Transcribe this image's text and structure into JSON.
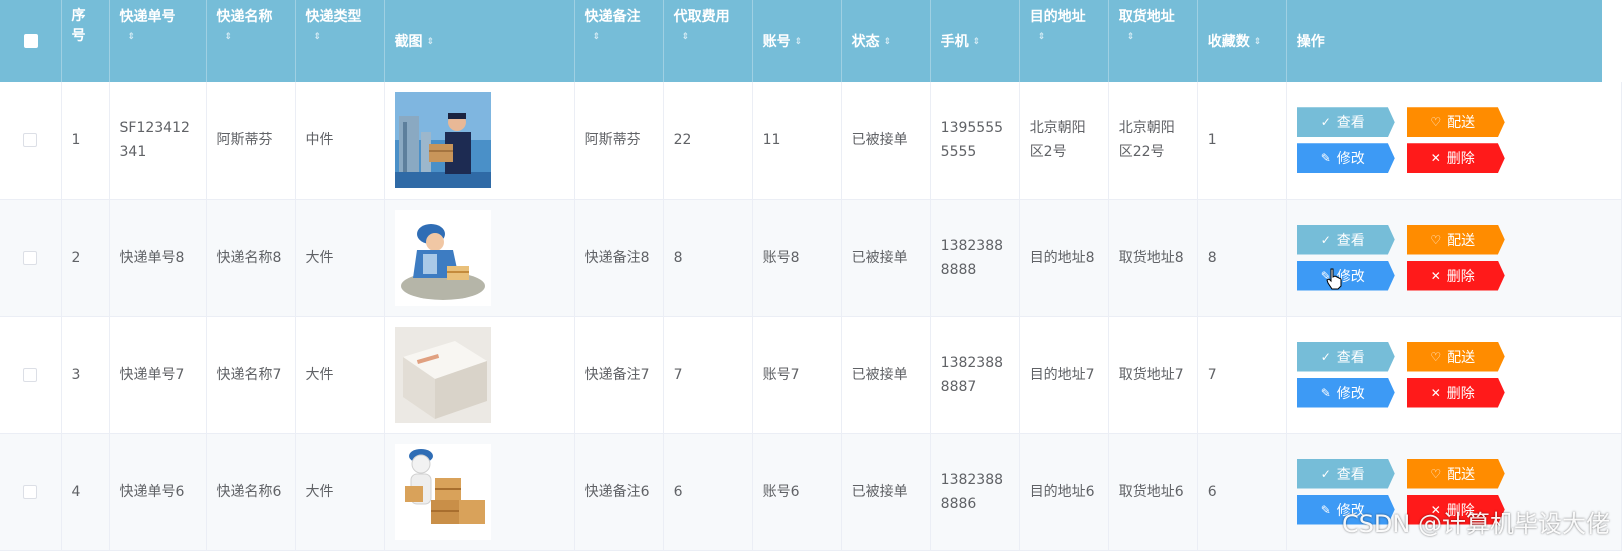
{
  "table": {
    "columns": {
      "index": "序号",
      "tracking_no": "快递单号",
      "name": "快递名称",
      "type": "快递类型",
      "screenshot": "截图",
      "remark": "快递备注",
      "fee": "代取费用",
      "account": "账号",
      "status": "状态",
      "phone": "手机",
      "destination": "目的地址",
      "pickup": "取货地址",
      "favorites": "收藏数",
      "actions": "操作"
    },
    "sort_icon": "⇕",
    "rows": [
      {
        "index": "1",
        "tracking_no": "SF123412341",
        "name": "阿斯蒂芬",
        "type": "中件",
        "remark": "阿斯蒂芬",
        "fee": "22",
        "account": "11",
        "status": "已被接单",
        "phone": "13955555555",
        "destination": "北京朝阳区2号",
        "pickup": "北京朝阳区22号",
        "favorites": "1",
        "image": "courier-photo"
      },
      {
        "index": "2",
        "tracking_no": "快递单号8",
        "name": "快递名称8",
        "type": "大件",
        "remark": "快递备注8",
        "fee": "8",
        "account": "账号8",
        "status": "已被接单",
        "phone": "13823888888",
        "destination": "目的地址8",
        "pickup": "取货地址8",
        "favorites": "8",
        "image": "courier-sign-illustration"
      },
      {
        "index": "3",
        "tracking_no": "快递单号7",
        "name": "快递名称7",
        "type": "大件",
        "remark": "快递备注7",
        "fee": "7",
        "account": "账号7",
        "status": "已被接单",
        "phone": "13823888887",
        "destination": "目的地址7",
        "pickup": "取货地址7",
        "favorites": "7",
        "image": "parcel-photo"
      },
      {
        "index": "4",
        "tracking_no": "快递单号6",
        "name": "快递名称6",
        "type": "大件",
        "remark": "快递备注6",
        "fee": "6",
        "account": "账号6",
        "status": "已被接单",
        "phone": "13823888886",
        "destination": "目的地址6",
        "pickup": "取货地址6",
        "favorites": "6",
        "image": "boxes-illustration"
      }
    ]
  },
  "actions": {
    "view": "查看",
    "deliver": "配送",
    "edit": "修改",
    "delete": "删除"
  },
  "icons": {
    "view": "✓",
    "deliver": "♡",
    "edit": "✎",
    "delete": "✕"
  },
  "colors": {
    "header": "#76bdd8",
    "view": "#76bdd8",
    "deliver": "#ff8c00",
    "edit": "#3d9af5",
    "delete": "#ff1a1a"
  },
  "watermark": "CSDN @计算机毕设大佬"
}
